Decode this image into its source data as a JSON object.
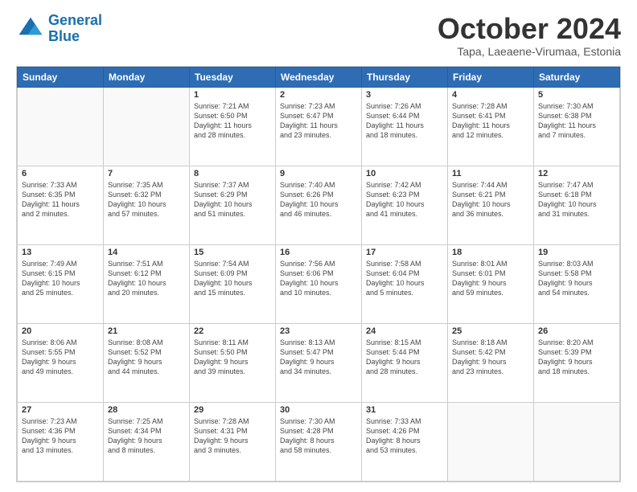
{
  "logo": {
    "line1": "General",
    "line2": "Blue"
  },
  "title": "October 2024",
  "subtitle": "Tapa, Laeaene-Virumaa, Estonia",
  "weekdays": [
    "Sunday",
    "Monday",
    "Tuesday",
    "Wednesday",
    "Thursday",
    "Friday",
    "Saturday"
  ],
  "weeks": [
    [
      {
        "day": "",
        "info": ""
      },
      {
        "day": "",
        "info": ""
      },
      {
        "day": "1",
        "info": "Sunrise: 7:21 AM\nSunset: 6:50 PM\nDaylight: 11 hours\nand 28 minutes."
      },
      {
        "day": "2",
        "info": "Sunrise: 7:23 AM\nSunset: 6:47 PM\nDaylight: 11 hours\nand 23 minutes."
      },
      {
        "day": "3",
        "info": "Sunrise: 7:26 AM\nSunset: 6:44 PM\nDaylight: 11 hours\nand 18 minutes."
      },
      {
        "day": "4",
        "info": "Sunrise: 7:28 AM\nSunset: 6:41 PM\nDaylight: 11 hours\nand 12 minutes."
      },
      {
        "day": "5",
        "info": "Sunrise: 7:30 AM\nSunset: 6:38 PM\nDaylight: 11 hours\nand 7 minutes."
      }
    ],
    [
      {
        "day": "6",
        "info": "Sunrise: 7:33 AM\nSunset: 6:35 PM\nDaylight: 11 hours\nand 2 minutes."
      },
      {
        "day": "7",
        "info": "Sunrise: 7:35 AM\nSunset: 6:32 PM\nDaylight: 10 hours\nand 57 minutes."
      },
      {
        "day": "8",
        "info": "Sunrise: 7:37 AM\nSunset: 6:29 PM\nDaylight: 10 hours\nand 51 minutes."
      },
      {
        "day": "9",
        "info": "Sunrise: 7:40 AM\nSunset: 6:26 PM\nDaylight: 10 hours\nand 46 minutes."
      },
      {
        "day": "10",
        "info": "Sunrise: 7:42 AM\nSunset: 6:23 PM\nDaylight: 10 hours\nand 41 minutes."
      },
      {
        "day": "11",
        "info": "Sunrise: 7:44 AM\nSunset: 6:21 PM\nDaylight: 10 hours\nand 36 minutes."
      },
      {
        "day": "12",
        "info": "Sunrise: 7:47 AM\nSunset: 6:18 PM\nDaylight: 10 hours\nand 31 minutes."
      }
    ],
    [
      {
        "day": "13",
        "info": "Sunrise: 7:49 AM\nSunset: 6:15 PM\nDaylight: 10 hours\nand 25 minutes."
      },
      {
        "day": "14",
        "info": "Sunrise: 7:51 AM\nSunset: 6:12 PM\nDaylight: 10 hours\nand 20 minutes."
      },
      {
        "day": "15",
        "info": "Sunrise: 7:54 AM\nSunset: 6:09 PM\nDaylight: 10 hours\nand 15 minutes."
      },
      {
        "day": "16",
        "info": "Sunrise: 7:56 AM\nSunset: 6:06 PM\nDaylight: 10 hours\nand 10 minutes."
      },
      {
        "day": "17",
        "info": "Sunrise: 7:58 AM\nSunset: 6:04 PM\nDaylight: 10 hours\nand 5 minutes."
      },
      {
        "day": "18",
        "info": "Sunrise: 8:01 AM\nSunset: 6:01 PM\nDaylight: 9 hours\nand 59 minutes."
      },
      {
        "day": "19",
        "info": "Sunrise: 8:03 AM\nSunset: 5:58 PM\nDaylight: 9 hours\nand 54 minutes."
      }
    ],
    [
      {
        "day": "20",
        "info": "Sunrise: 8:06 AM\nSunset: 5:55 PM\nDaylight: 9 hours\nand 49 minutes."
      },
      {
        "day": "21",
        "info": "Sunrise: 8:08 AM\nSunset: 5:52 PM\nDaylight: 9 hours\nand 44 minutes."
      },
      {
        "day": "22",
        "info": "Sunrise: 8:11 AM\nSunset: 5:50 PM\nDaylight: 9 hours\nand 39 minutes."
      },
      {
        "day": "23",
        "info": "Sunrise: 8:13 AM\nSunset: 5:47 PM\nDaylight: 9 hours\nand 34 minutes."
      },
      {
        "day": "24",
        "info": "Sunrise: 8:15 AM\nSunset: 5:44 PM\nDaylight: 9 hours\nand 28 minutes."
      },
      {
        "day": "25",
        "info": "Sunrise: 8:18 AM\nSunset: 5:42 PM\nDaylight: 9 hours\nand 23 minutes."
      },
      {
        "day": "26",
        "info": "Sunrise: 8:20 AM\nSunset: 5:39 PM\nDaylight: 9 hours\nand 18 minutes."
      }
    ],
    [
      {
        "day": "27",
        "info": "Sunrise: 7:23 AM\nSunset: 4:36 PM\nDaylight: 9 hours\nand 13 minutes."
      },
      {
        "day": "28",
        "info": "Sunrise: 7:25 AM\nSunset: 4:34 PM\nDaylight: 9 hours\nand 8 minutes."
      },
      {
        "day": "29",
        "info": "Sunrise: 7:28 AM\nSunset: 4:31 PM\nDaylight: 9 hours\nand 3 minutes."
      },
      {
        "day": "30",
        "info": "Sunrise: 7:30 AM\nSunset: 4:28 PM\nDaylight: 8 hours\nand 58 minutes."
      },
      {
        "day": "31",
        "info": "Sunrise: 7:33 AM\nSunset: 4:26 PM\nDaylight: 8 hours\nand 53 minutes."
      },
      {
        "day": "",
        "info": ""
      },
      {
        "day": "",
        "info": ""
      }
    ]
  ]
}
